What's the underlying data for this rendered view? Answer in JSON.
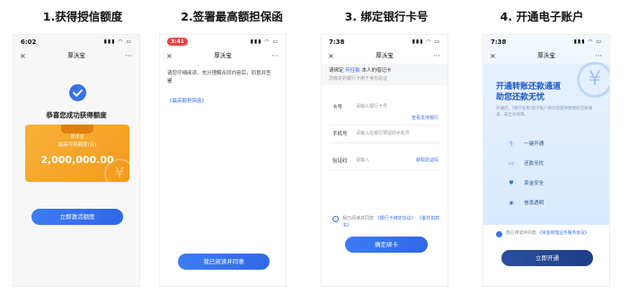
{
  "steps": [
    {
      "title": "1.获得授信额度"
    },
    {
      "title": "2.签署最高额担保函"
    },
    {
      "title": "3. 绑定银行卡号"
    },
    {
      "title": "4. 开通电子账户"
    }
  ],
  "phone1": {
    "time": "6:02",
    "nav_title": "厚沃宝",
    "close_icon": "×",
    "more_icon": "···",
    "congrats": "恭喜您成功获得额度",
    "card_badge": "厚沃宝",
    "card_label": "最高可用额度(元)",
    "card_amount": "2,000,000.00",
    "button": "立即激活额度"
  },
  "phone2": {
    "time": "3:41",
    "nav_title": "厚沃宝",
    "close_icon": "×",
    "more_icon": "···",
    "instruction": "请您仔细阅读、充分理解合同内容后，同意并签署",
    "doc_link": "《最高额担保函》",
    "button": "我已阅读并同意"
  },
  "phone3": {
    "time": "7:38",
    "nav_title": "厚沃宝",
    "close_icon": "×",
    "more_icon": "···",
    "header_prefix": "请绑定",
    "header_name": "何佳敏",
    "header_suffix": "本人的借记卡",
    "header_sub": "您绑定的银行卡用于身份验证",
    "card_label": "卡号",
    "card_placeholder": "请输入银行卡号",
    "supported_link": "查看支持银行",
    "phone_label": "手机号",
    "phone_placeholder": "请输入在银行预留的手机号",
    "code_label": "验证码",
    "code_placeholder": "请输入",
    "code_link": "获取验证码",
    "agreement_text": "我已阅读并同意",
    "agreement_link1": "《银行卡绑定协议》",
    "agreement_link2": "《委托扣款书》",
    "button": "确定绑卡"
  },
  "phone4": {
    "time": "7:38",
    "nav_title": "厚沃宝",
    "close_icon": "×",
    "more_icon": "···",
    "headline1": "开通转账还款通道",
    "headline2": "助您还款无忧",
    "desc": "开通后，[银行名称]电子账户将为您提供便捷的还款通道，安全有保障。",
    "features": [
      "一键开通",
      "还款无忧",
      "资金安全",
      "信息透明"
    ],
    "agreement_text": "我已阅读并同意",
    "agreement_link": "《资金管理业务服务协议》",
    "button": "立即开通"
  }
}
